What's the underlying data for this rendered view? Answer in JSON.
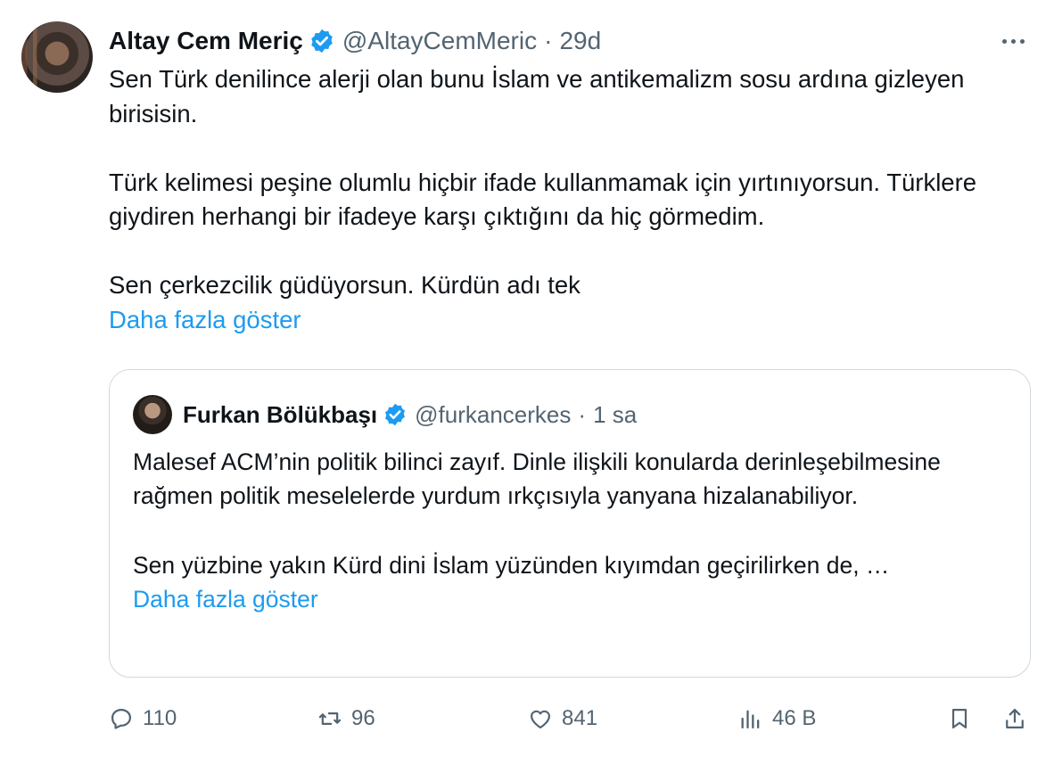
{
  "tweet": {
    "author": {
      "name": "Altay Cem Meriç",
      "handle": "@AltayCemMeric",
      "time": "29d"
    },
    "body": [
      "Sen Türk denilince alerji olan bunu İslam ve antikemalizm sosu ardına gizleyen birisisin.",
      "Türk kelimesi peşine olumlu hiçbir ifade kullanmamak için yırtınıyorsun. Türklere giydiren herhangi bir ifadeye karşı çıktığını da hiç görmedim.",
      "Sen çerkezcilik güdüyorsun. Kürdün adı tek"
    ],
    "show_more": "Daha fazla göster",
    "quote": {
      "name": "Furkan Bölükbaşı",
      "handle": "@furkancerkes",
      "time": "1 sa",
      "body": [
        "Malesef ACM’nin politik bilinci zayıf. Dinle ilişkili konularda derinleşebilmesine rağmen politik meselelerde yurdum ırkçısıyla yanyana hizalanabiliyor.",
        "Sen yüzbine yakın Kürd dini İslam yüzünden kıyımdan geçirilirken de, …"
      ],
      "show_more": "Daha fazla göster"
    },
    "actions": {
      "replies": "110",
      "reposts": "96",
      "likes": "841",
      "views": "46 B"
    }
  },
  "colors": {
    "link": "#1d9bf0",
    "muted": "#536471",
    "text": "#0f1419",
    "border": "#cfd9de"
  },
  "icons": [
    "verified-badge-icon",
    "more-icon",
    "reply-icon",
    "repost-icon",
    "like-icon",
    "views-icon",
    "bookmark-icon",
    "share-icon"
  ]
}
